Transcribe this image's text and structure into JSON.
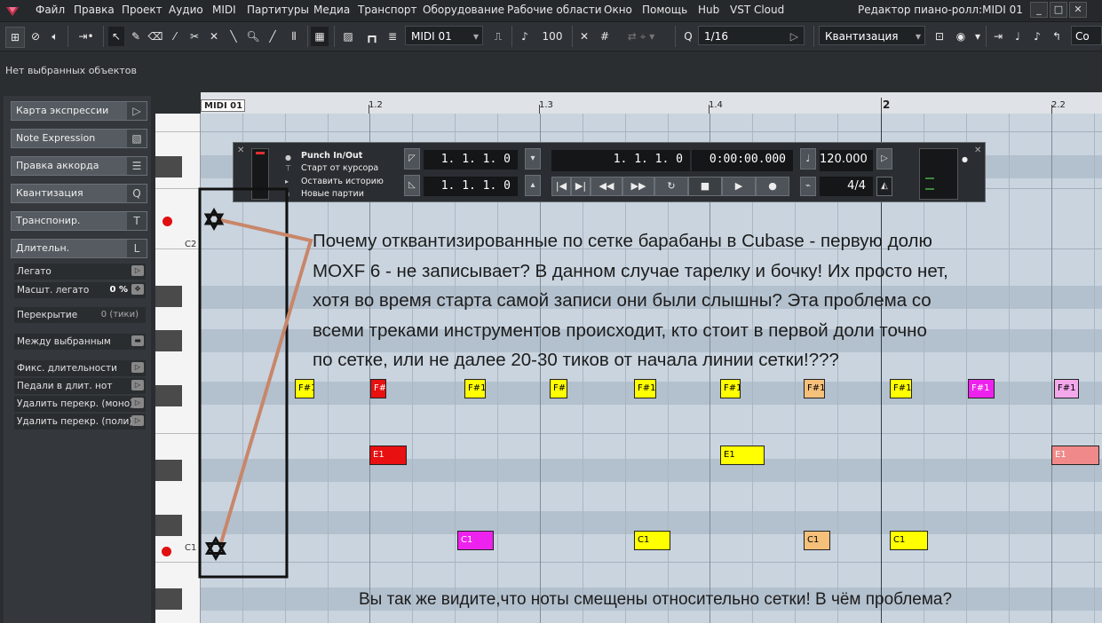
{
  "menubar": {
    "items": [
      "Файл",
      "Правка",
      "Проект",
      "Аудио",
      "MIDI",
      "Партитуры",
      "Медиа",
      "Транспорт",
      "Оборудование",
      "Рабочие области",
      "Окно",
      "Помощь",
      "Hub",
      "VST Cloud"
    ],
    "window_title": "Редактор пиано-ролл:MIDI 01"
  },
  "toolbar": {
    "part_name": "MIDI 01",
    "velocity": "100",
    "quantize": "1/16",
    "length_mode": "Квантизация",
    "color_label": "Co"
  },
  "info_line": "Нет выбранных объектов",
  "inspector": {
    "sections": [
      "Карта экспрессии",
      "Note Expression",
      "Правка аккорда",
      "Квантизация",
      "Транспонир.",
      "Длительн."
    ],
    "section_icons": [
      "▷",
      "▧",
      "☰",
      "Q",
      "T",
      "L"
    ],
    "rows": [
      {
        "label": "Легато",
        "value": ""
      },
      {
        "label": "Масшт. легато",
        "value": "0 %"
      },
      {
        "label": "Перекрытие",
        "value": "0 (тики)"
      },
      {
        "label": "Между выбранным",
        "value": ""
      },
      {
        "label": "Фикс. длительности",
        "value": ""
      },
      {
        "label": "Педали в длит. нот",
        "value": ""
      },
      {
        "label": "Удалить перекр. (моно)",
        "value": ""
      },
      {
        "label": "Удалить перекр. (поли)",
        "value": ""
      }
    ]
  },
  "keyboard": {
    "labels": [
      "C2",
      "C1"
    ]
  },
  "ruler": {
    "part_name": "MIDI 01",
    "labels": [
      "1.2",
      "1.3",
      "1.4",
      "2",
      "2.2"
    ]
  },
  "transport": {
    "punch": "Punch In/Out",
    "start_from_cursor": "Старт от курсора",
    "keep_history": "Оставить историю",
    "new_parts": "Новые партии",
    "left_locator": "1. 1. 1.   0",
    "right_locator": "1. 1. 1.   0",
    "position_bars": "1. 1. 1.   0",
    "position_time": "0:00:00.000",
    "tempo": "120.000",
    "signature": "4/4"
  },
  "notes": [
    {
      "label": "F#1",
      "color": "#ffff00"
    },
    {
      "label": "F#",
      "color": "#e81010"
    },
    {
      "label": "F#1",
      "color": "#ffff00"
    },
    {
      "label": "F#",
      "color": "#ffff00"
    },
    {
      "label": "F#1",
      "color": "#ffff00"
    },
    {
      "label": "F#1",
      "color": "#ffff00"
    },
    {
      "label": "F#1",
      "color": "#f5c07a"
    },
    {
      "label": "F#1",
      "color": "#ffff00"
    },
    {
      "label": "F#1",
      "color": "#ee22ee"
    },
    {
      "label": "F#1",
      "color": "#f4a8ec"
    },
    {
      "label": "E1",
      "color": "#e81010"
    },
    {
      "label": "E1",
      "color": "#ffff00"
    },
    {
      "label": "E1",
      "color": "#f08a8a"
    },
    {
      "label": "C1",
      "color": "#ee22ee"
    },
    {
      "label": "C1",
      "color": "#ffff00"
    },
    {
      "label": "C1",
      "color": "#f5c07a"
    },
    {
      "label": "C1",
      "color": "#ffff00"
    }
  ],
  "annotation": {
    "lines": [
      "Почему отквантизированные по сетке барабаны в Cubase - первую долю",
      "MOXF 6 - не записывает? В данном случае тарелку и бочку! Их просто нет,",
      "хотя во время старта самой записи они были слышны? Эта проблема со",
      "всеми треками инструментов происходит, кто стоит в первой доли точно",
      "по сетке, или не далее 20-30 тиков от начала линии сетки!???"
    ],
    "bottom": "Вы так же видите,что ноты смещены относительно сетки! В чём проблема?"
  }
}
